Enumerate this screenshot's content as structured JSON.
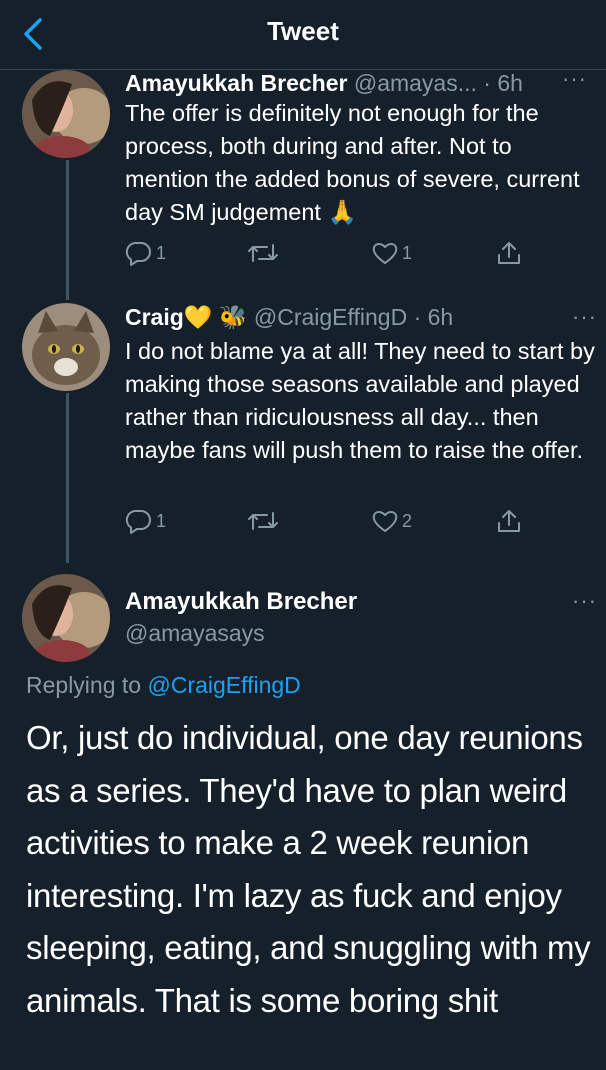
{
  "header": {
    "title": "Tweet",
    "back_icon": "chevron-left-icon",
    "accent": "#1da1f2"
  },
  "tweets": [
    {
      "name": "Amayukkah Brecher",
      "handle": "@amayas...",
      "time": "· 6h",
      "text": "The offer is definitely not enough for the process, both during and after. Not to mention the added bonus of severe, current day SM judgement 🙏",
      "replies": "1",
      "retweets": "",
      "likes": "1"
    },
    {
      "name": "Craig💛 🐝",
      "handle": "@CraigEffingD",
      "time": "· 6h",
      "text": "I do not blame ya at all! They need to start by making those seasons available and played rather than ridiculousness all day... then maybe fans will push them to raise the offer.",
      "replies": "1",
      "retweets": "",
      "likes": "2"
    }
  ],
  "main_tweet": {
    "name": "Amayukkah Brecher",
    "handle": "@amayasays",
    "replying_prefix": "Replying to",
    "replying_to": "@CraigEffingD",
    "text": "Or, just do individual, one day reunions as a series. They'd have to plan weird activities to make a 2 week reunion interesting. I'm lazy as fuck and enjoy sleeping, eating, and snuggling with my animals. That is some boring shit"
  },
  "colors": {
    "background": "#15202b",
    "secondary_text": "#8899a6",
    "link": "#1da1f2",
    "divider": "#38444d"
  }
}
